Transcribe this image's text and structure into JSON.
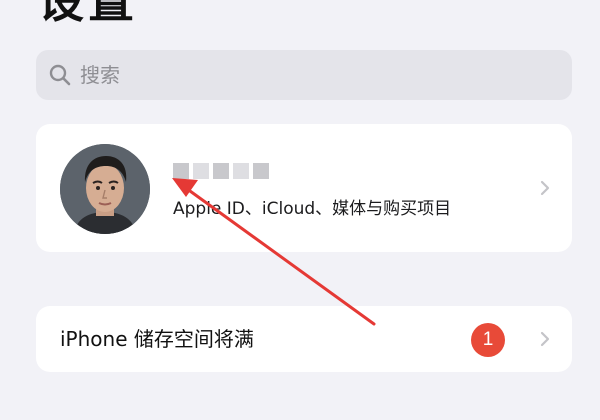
{
  "page": {
    "title": "设置"
  },
  "search": {
    "placeholder": "搜索",
    "icon": "search-icon"
  },
  "profile": {
    "name": "",
    "name_obscured": true,
    "subtitle": "Apple ID、iCloud、媒体与购买项目",
    "icon": "chevron-right-icon"
  },
  "storage": {
    "label": "iPhone 储存空间将满",
    "badge": "1",
    "badge_color": "#e84a38",
    "icon": "chevron-right-icon"
  },
  "annotation": {
    "color": "#e53935"
  }
}
